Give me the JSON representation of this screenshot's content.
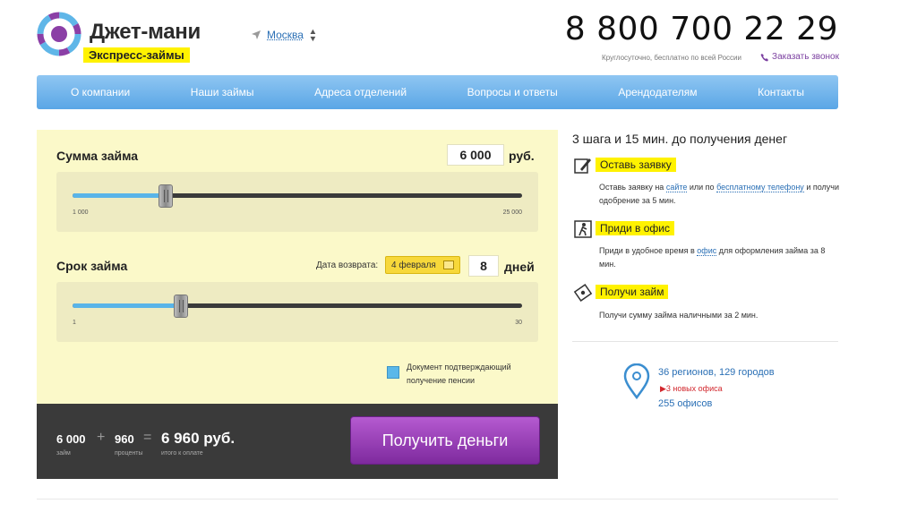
{
  "header": {
    "brand": "Джет-мани",
    "tagline": "Экспресс-займы",
    "city": "Москва",
    "phone": "8 800 700 22 29",
    "phone_note": "Круглосуточно, бесплатно по всей России",
    "callback": "Заказать звонок"
  },
  "nav": [
    "О компании",
    "Наши займы",
    "Адреса отделений",
    "Вопросы и ответы",
    "Арендодателям",
    "Контакты"
  ],
  "calculator": {
    "amount_label": "Сумма займа",
    "amount_value": "6 000",
    "amount_unit": "руб.",
    "amount_min": "1 000",
    "amount_max": "25 000",
    "amount_fraction": 0.208,
    "term_label": "Срок займа",
    "return_label": "Дата возврата:",
    "return_date": "4 февраля",
    "term_value": "8",
    "term_unit": "дней",
    "term_min": "1",
    "term_max": "30",
    "term_fraction": 0.241,
    "pension_doc": "Документ подтверждающий получение пенсии",
    "summary": {
      "loan": "6 000",
      "loan_sub": "займ",
      "plus": "+",
      "interest": "960",
      "interest_sub": "проценты",
      "equals": "=",
      "total": "6 960 руб.",
      "total_sub": "итого к оплате"
    },
    "cta": "Получить деньги"
  },
  "steps": {
    "title": "3 шага и 15 мин. до получения денег",
    "items": [
      {
        "title": "Оставь заявку",
        "text_1": "Оставь заявку на ",
        "link_1": "сайте",
        "text_2": " или по ",
        "link_2": "бесплатному телефону",
        "text_3": " и получи одобрение за 5 мин."
      },
      {
        "title": "Приди в офис",
        "text_1": "Приди в удобное время в ",
        "link_1": "офис",
        "text_2": " для оформления займа за 8 мин."
      },
      {
        "title": "Получи займ",
        "text_1": "Получи сумму займа наличными за 2 мин."
      }
    ]
  },
  "coverage": {
    "regions": "36 регионов, 129 городов",
    "new_offices": "3 новых офиса",
    "offices": "255 офисов"
  }
}
